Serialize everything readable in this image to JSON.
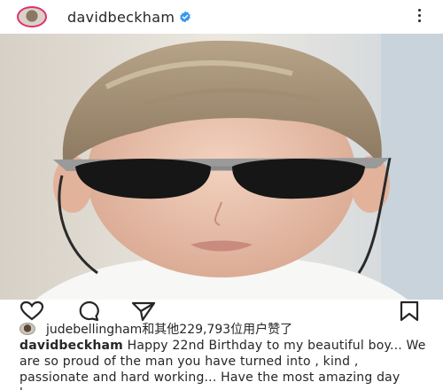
{
  "post": {
    "username": "davidbeckham",
    "liked_by_user": "judebellingham",
    "liked_by_rest": "和其他229,793位用户赞了",
    "caption_user": "davidbeckham",
    "caption_text": "Happy 22nd Birthday to my beautiful boy... We are so proud of the man you have turned into , kind , passionate and hard working... Have the most amazing day because you"
  },
  "icons": {
    "verified": "verified-badge-icon",
    "more": "more-options-icon",
    "like": "heart-icon",
    "comment": "comment-icon",
    "share": "share-icon",
    "save": "bookmark-icon"
  },
  "colors": {
    "verified": "#3897f0",
    "story_ring": "#e1306c",
    "text": "#262626"
  }
}
